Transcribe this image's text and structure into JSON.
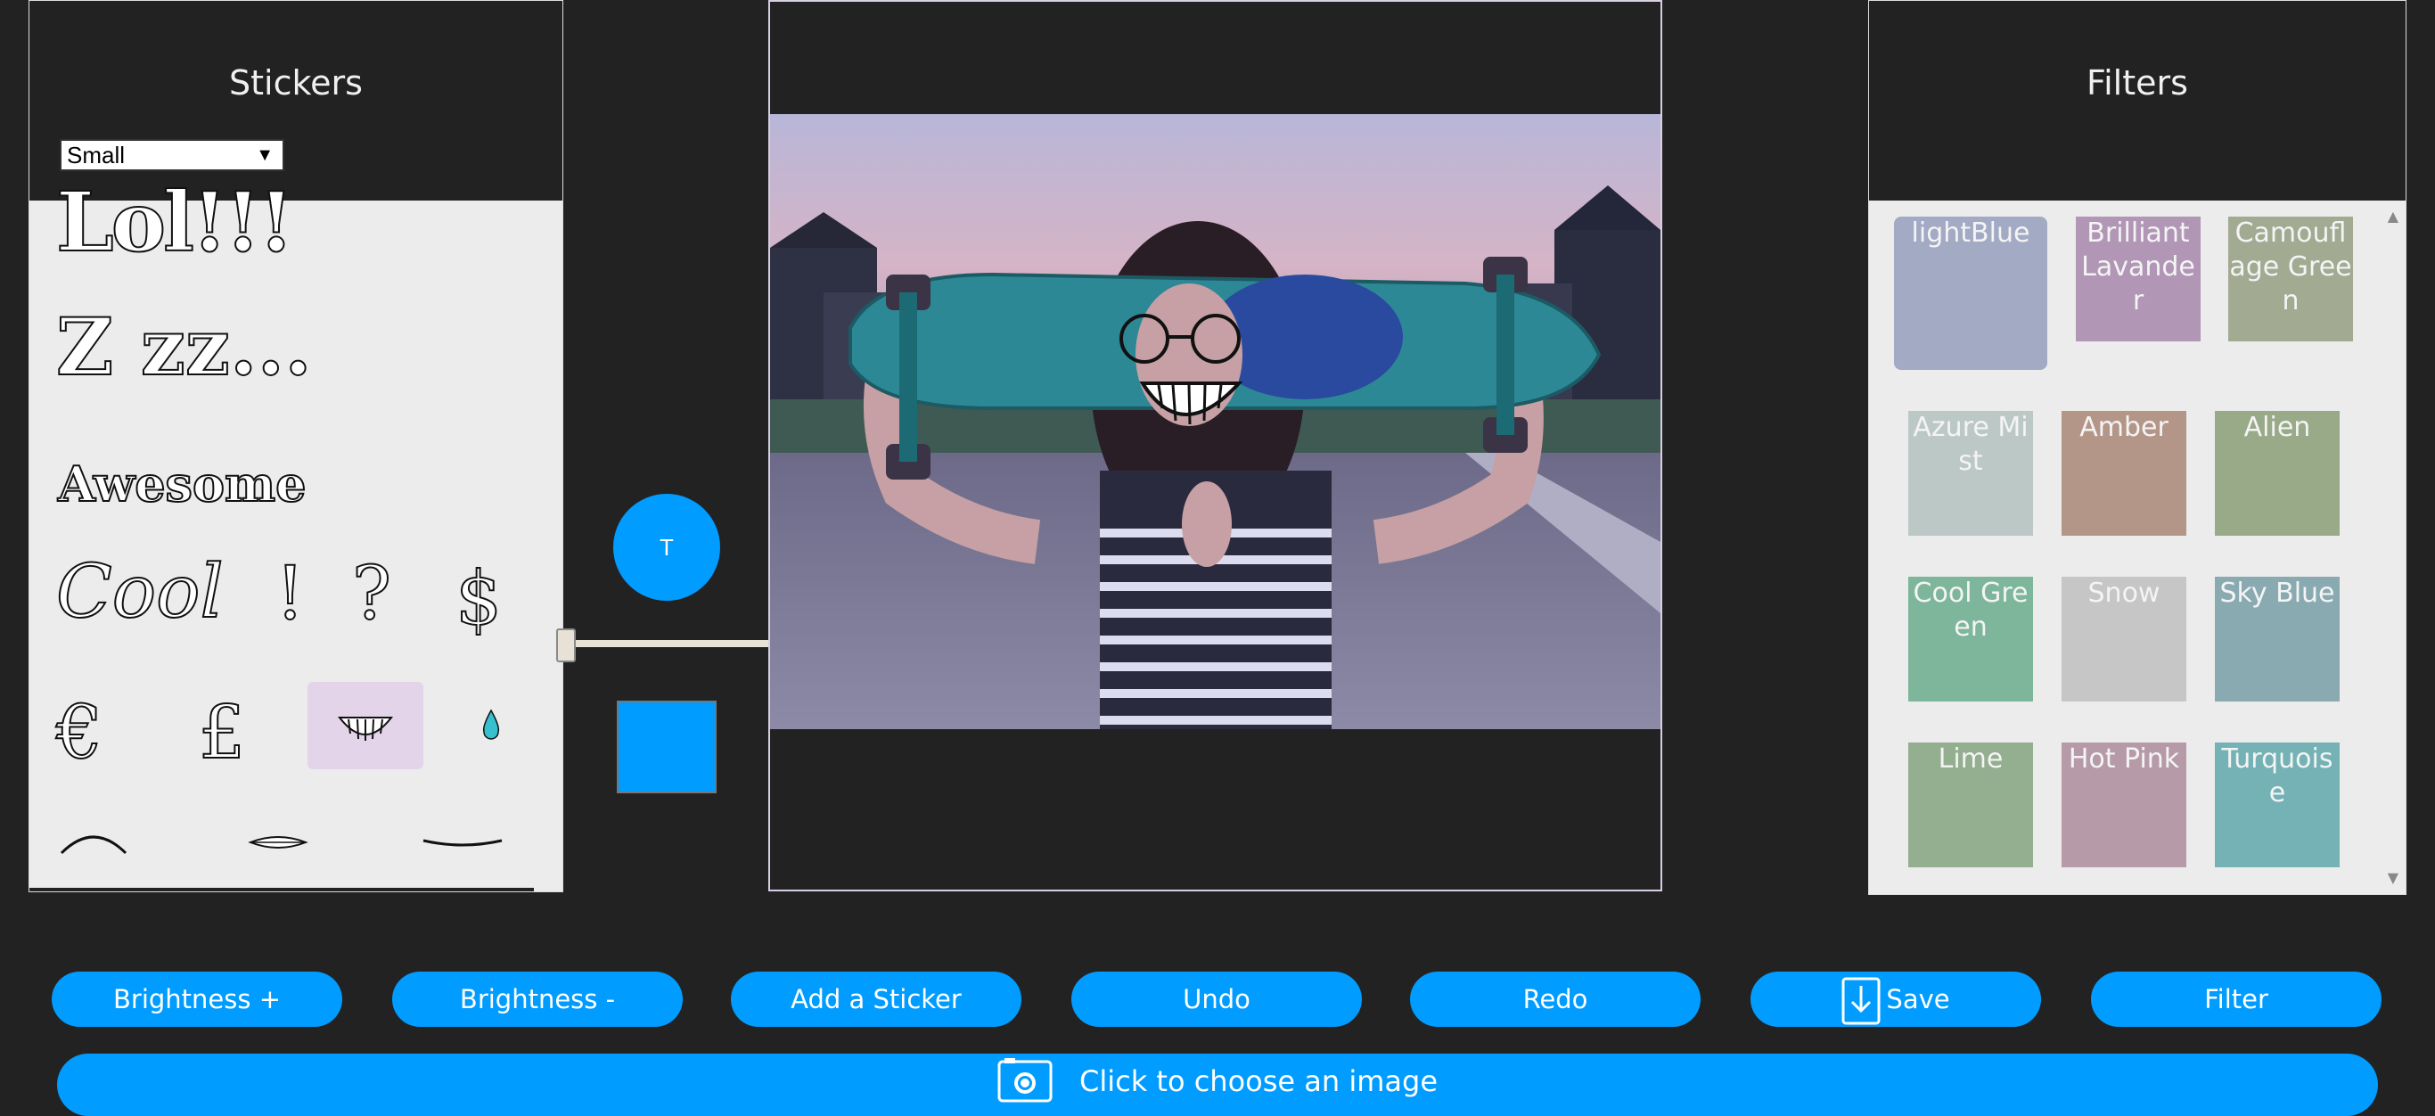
{
  "stickers": {
    "title": "Stickers",
    "size_value": "Small",
    "items": {
      "lol": "Lol!!!",
      "zzz": "Z zz...",
      "awesome": "Awesome",
      "cool": "Cool",
      "exclaim": "!",
      "question": "?",
      "dollar": "$",
      "euro": "€",
      "pound": "£"
    }
  },
  "text_tool_label": "T",
  "accent_color": "#009cff",
  "filters": {
    "title": "Filters",
    "items": [
      {
        "label": "lightBlue",
        "color": "#a2aac4"
      },
      {
        "label": "Brilliant Lavander",
        "color": "#b196b6"
      },
      {
        "label": "Camouflage Green",
        "color": "#a2aa92"
      },
      {
        "label": "Azure Mist",
        "color": "#bcc8c6"
      },
      {
        "label": "Amber",
        "color": "#b39688"
      },
      {
        "label": "Alien",
        "color": "#98aa88"
      },
      {
        "label": "Cool Green",
        "color": "#7eb69c"
      },
      {
        "label": "Snow",
        "color": "#c6c6c6"
      },
      {
        "label": "Sky Blue",
        "color": "#8aaab2"
      },
      {
        "label": "Lime",
        "color": "#94ae90"
      },
      {
        "label": "Hot Pink",
        "color": "#b69aa8"
      },
      {
        "label": "Turquoise",
        "color": "#74b2b6"
      }
    ]
  },
  "toolbar": {
    "brightness_up": "Brightness +",
    "brightness_down": "Brightness -",
    "add_sticker": "Add a Sticker",
    "undo": "Undo",
    "redo": "Redo",
    "save": "Save",
    "filter": "Filter"
  },
  "choose_image": "Click to choose an image"
}
